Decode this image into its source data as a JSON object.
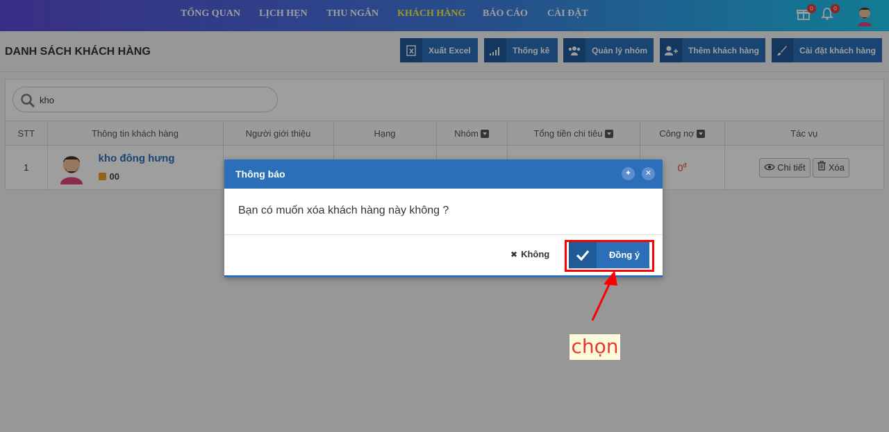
{
  "nav": {
    "links": [
      "TỔNG QUAN",
      "LỊCH HẸN",
      "THU NGÂN",
      "KHÁCH HÀNG",
      "BÁO CÁO",
      "CÀI ĐẶT"
    ],
    "active": "KHÁCH HÀNG",
    "gift_badge": "0",
    "bell_badge": "0"
  },
  "header": {
    "title": "DANH SÁCH KHÁCH HÀNG",
    "buttons": [
      "Xuất Excel",
      "Thống kê",
      "Quản lý nhóm",
      "Thêm khách hàng",
      "Cài đặt khách hàng"
    ]
  },
  "search": {
    "value": "kho"
  },
  "table": {
    "columns": [
      "STT",
      "Thông tin khách hàng",
      "Người giới thiệu",
      "Hạng",
      "Nhóm",
      "Tổng tiền chi tiêu",
      "Công nợ",
      "Tác vụ"
    ],
    "rows": [
      {
        "stt": "1",
        "name": "kho đông hưng",
        "phone": "00",
        "debt": "0",
        "debt_unit": "đ",
        "detail": "Chi tiết",
        "delete": "Xóa"
      }
    ]
  },
  "modal": {
    "title": "Thông báo",
    "message": "Bạn có muốn xóa khách hàng này không ?",
    "cancel": "Không",
    "confirm": "Đồng ý"
  },
  "annotation": "chọn",
  "colors": {
    "primary": "#2a6fb8",
    "highlight": "#ff0000",
    "active_nav": "#fff13a"
  }
}
